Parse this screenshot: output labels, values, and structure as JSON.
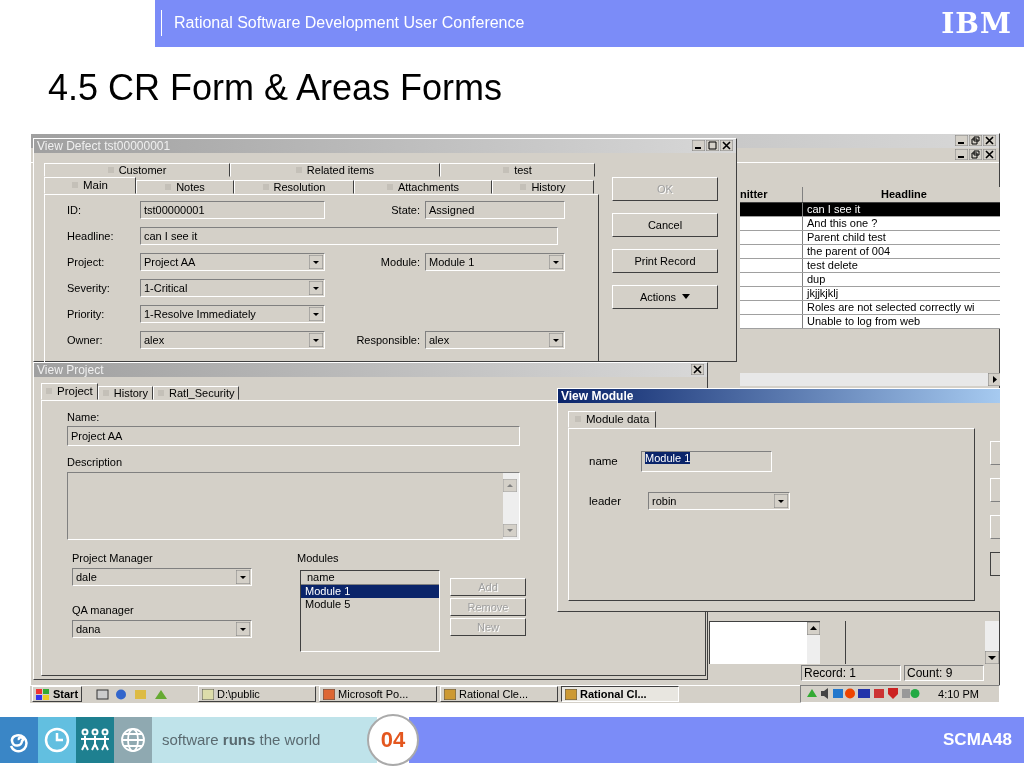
{
  "header": {
    "conference": "Rational Software Development User Conference",
    "logo": "IBM"
  },
  "slide_title": "4.5 CR Form & Areas Forms",
  "main_window": {
    "active": false,
    "columns": [
      "nitter",
      "Headline"
    ],
    "rows": [
      {
        "headline": "can I see it",
        "selected": true
      },
      {
        "headline": "And this one ?",
        "selected": false
      },
      {
        "headline": "Parent child test",
        "selected": false
      },
      {
        "headline": "the parent of 004",
        "selected": false
      },
      {
        "headline": "test delete",
        "selected": false
      },
      {
        "headline": "dup",
        "selected": false
      },
      {
        "headline": "jkjjkjklj",
        "selected": false
      },
      {
        "headline": "Roles are not selected correctly wi",
        "selected": false
      },
      {
        "headline": "Unable to log from web",
        "selected": false
      }
    ],
    "status": [
      "Record: 1",
      "Count: 9"
    ]
  },
  "defect_window": {
    "title": "View Defect tst00000001",
    "active": false,
    "tab_rows": [
      [
        {
          "label": "Customer",
          "selected": false
        },
        {
          "label": "Related items",
          "selected": false
        },
        {
          "label": "test",
          "selected": false
        }
      ],
      [
        {
          "label": "Main",
          "selected": true
        },
        {
          "label": "Notes",
          "selected": false
        },
        {
          "label": "Resolution",
          "selected": false
        },
        {
          "label": "Attachments",
          "selected": false
        },
        {
          "label": "History",
          "selected": false
        }
      ]
    ],
    "rows": [
      {
        "fields": [
          {
            "label": "ID:",
            "value": "tst00000001",
            "kind": "text"
          },
          {
            "label": "State:",
            "value": "Assigned",
            "kind": "text"
          }
        ]
      },
      {
        "fields": [
          {
            "label": "Headline:",
            "value": "can I see it",
            "kind": "text"
          }
        ]
      },
      {
        "fields": [
          {
            "label": "Project:",
            "value": "Project AA",
            "kind": "combo"
          },
          {
            "label": "Module:",
            "value": "Module 1",
            "kind": "combo"
          }
        ]
      },
      {
        "fields": [
          {
            "label": "Severity:",
            "value": "1-Critical",
            "kind": "combo"
          }
        ]
      },
      {
        "fields": [
          {
            "label": "Priority:",
            "value": "1-Resolve Immediately",
            "kind": "combo"
          }
        ]
      },
      {
        "fields": [
          {
            "label": "Owner:",
            "value": "alex",
            "kind": "combo"
          },
          {
            "label": "Responsible:",
            "value": "alex",
            "kind": "combo"
          }
        ]
      }
    ],
    "buttons": [
      {
        "label": "OK",
        "disabled": true,
        "kind": "push"
      },
      {
        "label": "Cancel",
        "disabled": false,
        "kind": "push"
      },
      {
        "label": "Print Record",
        "disabled": false,
        "kind": "push"
      },
      {
        "label": "Actions",
        "disabled": false,
        "kind": "menu"
      }
    ]
  },
  "project_window": {
    "title": "View Project",
    "active": false,
    "tabs": [
      {
        "label": "Project",
        "selected": true
      },
      {
        "label": "History",
        "selected": false
      },
      {
        "label": "Ratl_Security",
        "selected": false
      }
    ],
    "name_label": "Name:",
    "name_value": "Project AA",
    "description_label": "Description",
    "managers": [
      {
        "label": "Project Manager",
        "value": "dale"
      },
      {
        "label": "QA manager",
        "value": "dana"
      }
    ],
    "modules": {
      "label": "Modules",
      "column": "name",
      "items": [
        {
          "label": "Module 1",
          "selected": true
        },
        {
          "label": "Module 5",
          "selected": false
        }
      ],
      "buttons": [
        {
          "label": "Add",
          "disabled": true
        },
        {
          "label": "Remove",
          "disabled": true
        },
        {
          "label": "New",
          "disabled": true
        }
      ]
    }
  },
  "module_window": {
    "title": "View Module",
    "active": true,
    "tabs": [
      {
        "label": "Module data",
        "selected": true
      }
    ],
    "fields": [
      {
        "label": "name",
        "value": "Module 1",
        "kind": "text",
        "text_selected": true
      },
      {
        "label": "leader",
        "value": "robin",
        "kind": "combo",
        "text_selected": false
      }
    ]
  },
  "taskbar": {
    "start": "Start",
    "tasks": [
      {
        "label": "D:\\public",
        "selected": false
      },
      {
        "label": "Microsoft Po...",
        "selected": false
      },
      {
        "label": "Rational Cle...",
        "selected": false
      },
      {
        "label": "Rational Cl...",
        "selected": true
      }
    ],
    "clock": "4:10 PM"
  },
  "footer": {
    "tagline": "software **runs** the world",
    "badge": "04",
    "code": "SCMA48"
  }
}
